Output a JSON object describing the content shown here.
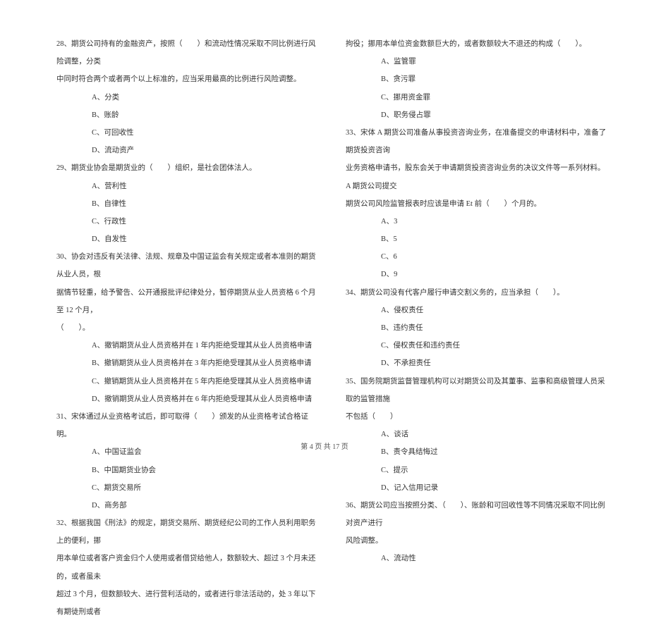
{
  "left_col": {
    "q28_l1": "28、期货公司持有的金融资产，按照（　　）和流动性情况采取不同比例进行风险调整，分类",
    "q28_l2": "中同时符合两个或者两个以上标准的，应当采用最高的比例进行风险调整。",
    "q28_a": "A、分类",
    "q28_b": "B、账龄",
    "q28_c": "C、可回收性",
    "q28_d": "D、流动资产",
    "q29_l1": "29、期货业协会是期货业的（　　）组织，是社会团体法人。",
    "q29_a": "A、营利性",
    "q29_b": "B、自律性",
    "q29_c": "C、行政性",
    "q29_d": "D、自发性",
    "q30_l1": "30、协会对违反有关法律、法规、规章及中国证监会有关规定或者本准则的期货从业人员，根",
    "q30_l2": "据情节轻重，给予警告、公开通报批评纪律处分，暂停期货从业人员资格 6 个月至 12 个月，",
    "q30_l3": "（　　）。",
    "q30_a": "A、撤销期货从业人员资格并在 1 年内拒绝受理其从业人员资格申请",
    "q30_b": "B、撤销期货从业人员资格并在 3 年内拒绝受理其从业人员资格申请",
    "q30_c": "C、撤销期货从业人员资格并在 5 年内拒绝受理其从业人员资格申请",
    "q30_d": "D、撤销期货从业人员资格并在 6 年内拒绝受理其从业人员资格申请",
    "q31_l1": "31、宋体通过从业资格考试后，即可取得（　　）颁发的从业资格考试合格证明。",
    "q31_a": "A、中国证监会",
    "q31_b": "B、中国期货业协会",
    "q31_c": "C、期货交易所",
    "q31_d": "D、商务部",
    "q32_l1": "32、根据我国《刑法》的规定，期货交易所、期货经纪公司的工作人员利用职务上的便利，挪",
    "q32_l2": "用本单位或者客户资金归个人使用或者借贷给他人，数额较大、超过 3 个月未还的，或者虽未",
    "q32_l3": "超过 3 个月，但数额较大、进行营利活动的，或者进行非法活动的，处 3 年以下有期徒刑或者"
  },
  "right_col": {
    "q32_l4": "拘役；挪用本单位资金数额巨大的，或者数额较大不退还的构成（　　）。",
    "q32_a": "A、监管罪",
    "q32_b": "B、贪污罪",
    "q32_c": "C、挪用资金罪",
    "q32_d": "D、职务侵占罪",
    "q33_l1": "33、宋体 A 期货公司准备从事投资咨询业务，在准备提交的申请材料中，准备了期货投资咨询",
    "q33_l2": "业务资格申请书，股东会关于申请期货投资咨询业务的决议文件等一系列材料。A 期货公司提交",
    "q33_l3": "期货公司风险监管报表时应该是申请 Et 前（　　）个月的。",
    "q33_a": "A、3",
    "q33_b": "B、5",
    "q33_c": "C、6",
    "q33_d": "D、9",
    "q34_l1": "34、期货公司没有代客户履行申请交割义务的，应当承担（　　）。",
    "q34_a": "A、侵权责任",
    "q34_b": "B、违约责任",
    "q34_c": "C、侵权责任和违约责任",
    "q34_d": "D、不承担责任",
    "q35_l1": "35、国务院期货监督管理机构可以对期货公司及其董事、监事和高级管理人员采取的监管措施",
    "q35_l2": "不包括（　　）",
    "q35_a": "A、谈话",
    "q35_b": "B、责令具结悔过",
    "q35_c": "C、提示",
    "q35_d": "D、记入信用记录",
    "q36_l1": "36、期货公司应当按照分类、（　　）、账龄和可回收性等不同情况采取不同比例对资产进行",
    "q36_l2": "风险调整。",
    "q36_a": "A、流动性"
  },
  "footer": "第 4 页 共 17 页"
}
